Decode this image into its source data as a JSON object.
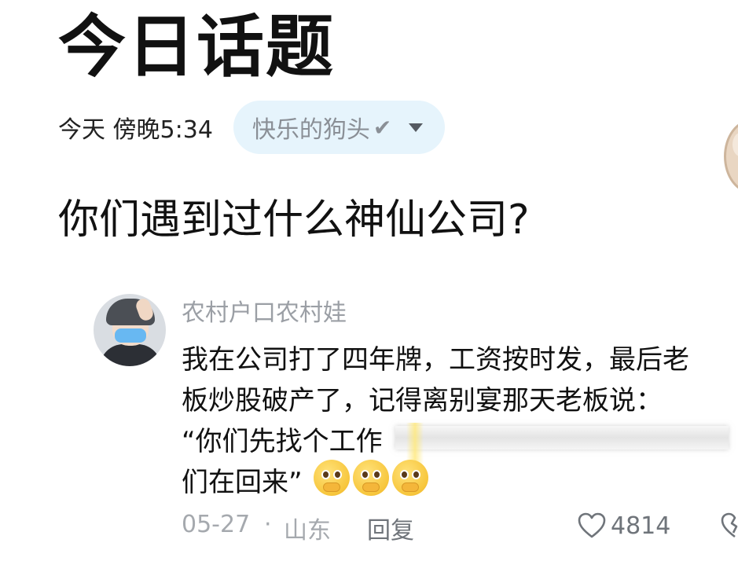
{
  "header": {
    "page_title": "今日话题",
    "post_time": "今天 傍晚5:34",
    "author_name": "快乐的狗头",
    "verified_glyph": "✔",
    "author_menu_icon": "chevron-down-icon"
  },
  "post": {
    "question": "你们遇到过什么神仙公司?"
  },
  "comment": {
    "username": "农村户口农村娃",
    "lines": [
      "我在公司打了四年牌，工资按时发，最后老",
      "板炒股破产了，记得离别宴那天老板说：",
      "“你们先找个工作",
      "们在回来”"
    ],
    "emojis": [
      "pleading-face-emoji",
      "pleading-face-emoji",
      "pleading-face-emoji"
    ],
    "date": "05-27",
    "separator": "·",
    "location": "山东",
    "reply_label": "回复",
    "like_count": "4814",
    "icons": {
      "like": "heart-icon",
      "dislike": "broken-heart-icon"
    },
    "colors": {
      "chip_background": "#e6f4fc",
      "meta_gray": "#a5a9ae"
    }
  }
}
